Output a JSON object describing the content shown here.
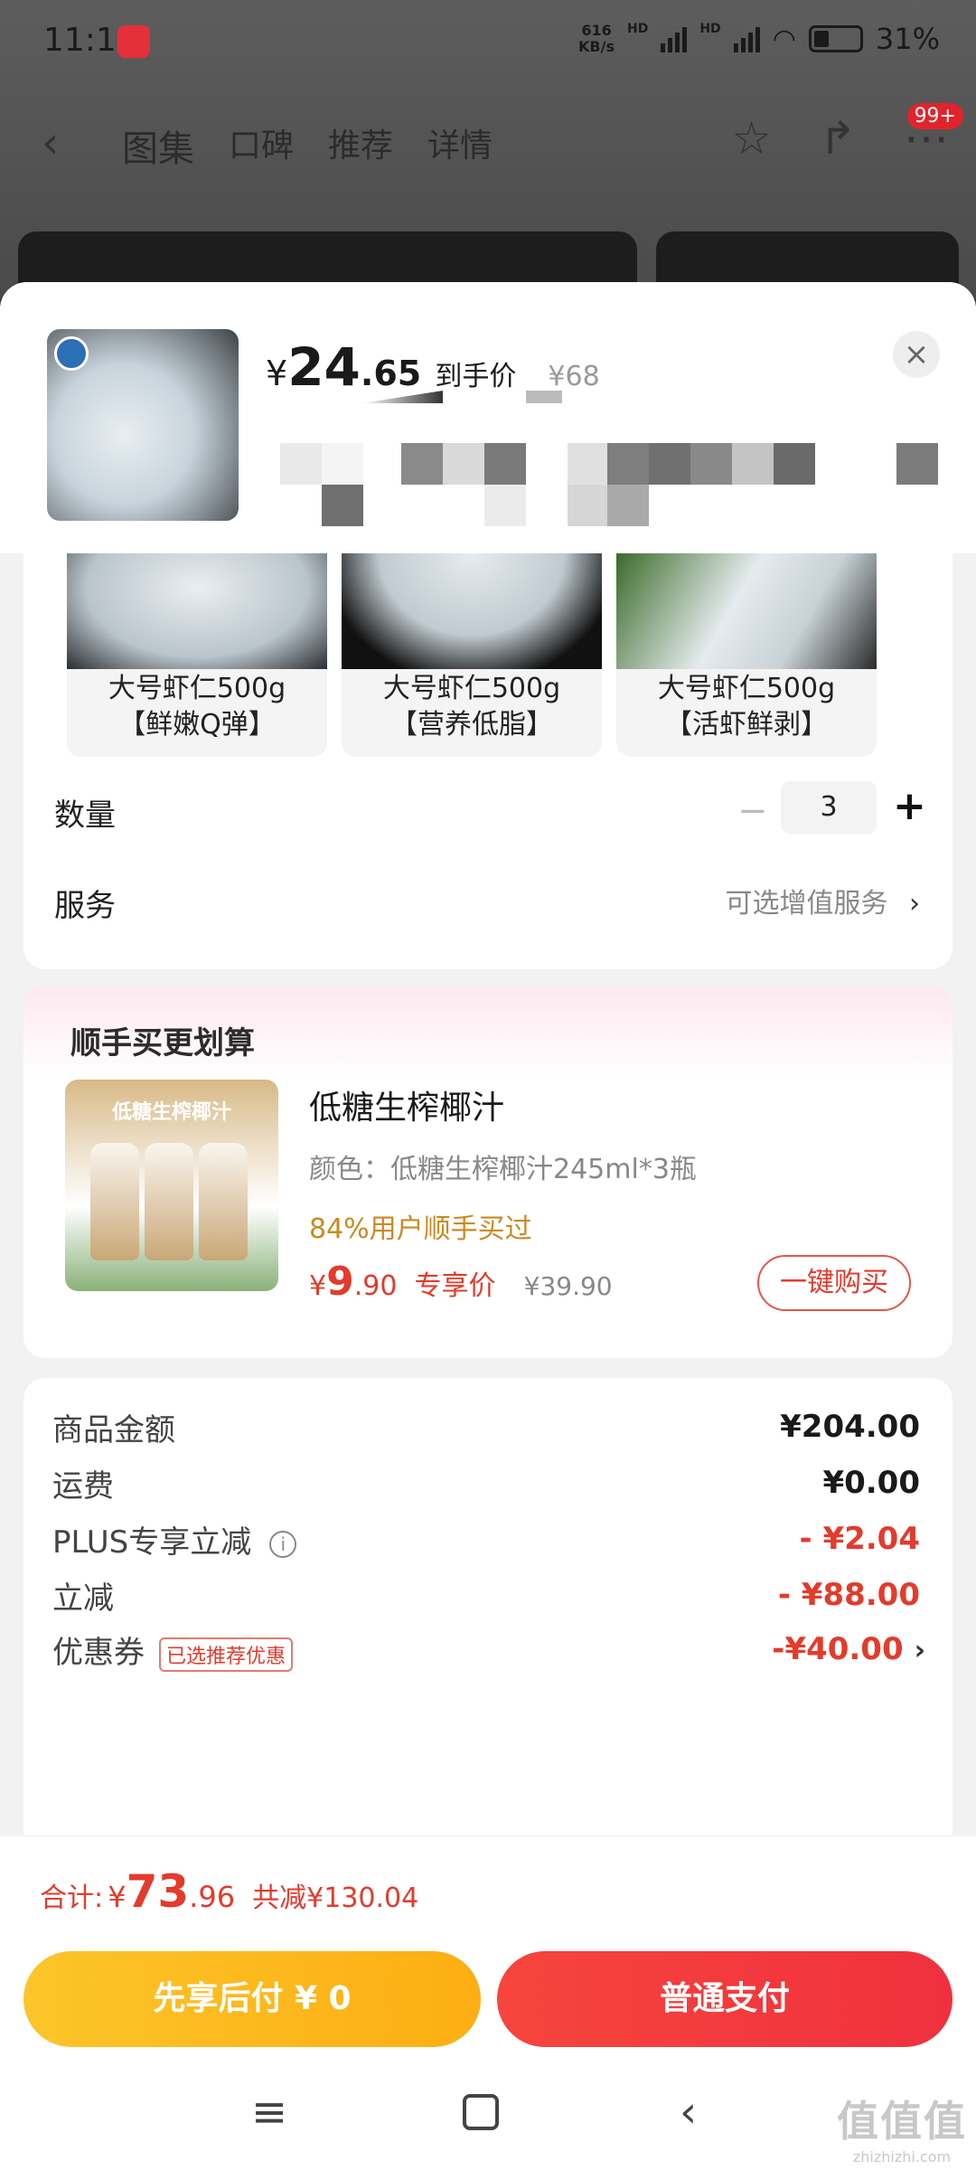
{
  "status": {
    "time": "11:14",
    "net_speed_top": "616",
    "net_speed_bottom": "KB/s",
    "hd1": "HD",
    "hd2": "HD",
    "battery": "31%"
  },
  "nav": {
    "tabs": [
      "图集",
      "口碑",
      "推荐",
      "详情"
    ],
    "badge": "99+"
  },
  "product": {
    "price_currency": "¥",
    "price_int": "24",
    "price_dec": ".65",
    "price_tag": "到手价",
    "orig_price": "¥68"
  },
  "options": [
    {
      "line1": "大号虾仁500g",
      "line2": "【鲜嫩Q弹】"
    },
    {
      "line1": "大号虾仁500g",
      "line2": "【营养低脂】"
    },
    {
      "line1": "大号虾仁500g",
      "line2": "【活虾鲜剥】"
    }
  ],
  "quantity": {
    "label": "数量",
    "minus": "−",
    "value": "3",
    "plus": "+"
  },
  "service": {
    "label": "服务",
    "value": "可选增值服务",
    "chevron": "›"
  },
  "addon": {
    "heading": "顺手买更划算",
    "image_banner": "低糖生榨椰汁",
    "title": "低糖生榨椰汁",
    "spec": "颜色：低糖生榨椰汁245ml*3瓶",
    "bought": "84%用户顺手买过",
    "price_currency": "¥",
    "price_int": "9",
    "price_dec": ".90",
    "price_tag": "专享价",
    "orig_price": "¥39.90",
    "buy_label": "一键购买"
  },
  "summary": [
    {
      "label": "商品金额",
      "value": "¥204.00"
    },
    {
      "label": "运费",
      "value": "¥0.00"
    },
    {
      "label": "PLUS专享立减",
      "value": "- ¥2.04",
      "info": "i"
    },
    {
      "label": "立减",
      "value": "- ¥88.00"
    },
    {
      "label": "优惠券",
      "value": "-¥40.00",
      "chip": "已选推荐优惠",
      "chevron": "›"
    }
  ],
  "total": {
    "label": "合计:",
    "currency": "¥",
    "int": "73",
    "dec": ".96",
    "reduce": "共减¥130.04"
  },
  "buttons": {
    "pay_later": "先享后付 ¥ 0",
    "pay_normal": "普通支付"
  },
  "watermark": {
    "big": "值值值",
    "small": "zhizhizhi.com"
  },
  "colors": {
    "accent_red": "#e33b2c",
    "pay_later_yellow": "#fdb518",
    "sheet_bg": "#f2f2f2"
  }
}
